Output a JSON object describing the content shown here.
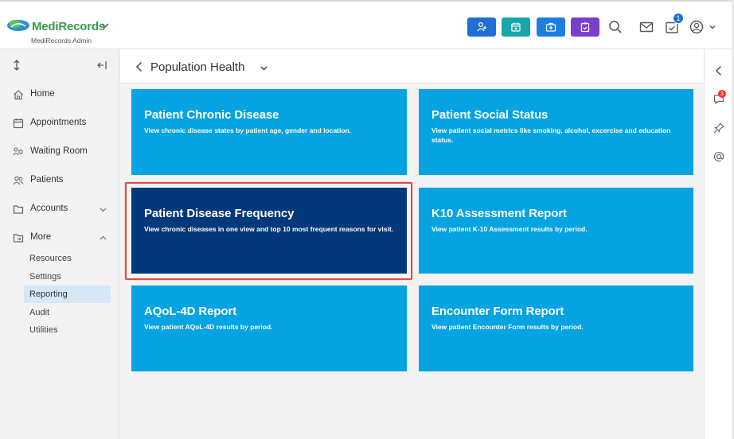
{
  "header": {
    "brand": "MediRecords",
    "subtitle": "MediRecords Admin",
    "notification_count": "1",
    "action_buttons": [
      {
        "icon": "add-user-icon",
        "color": "#1e6fd6"
      },
      {
        "icon": "calendar-icon",
        "color": "#1aa6a6"
      },
      {
        "icon": "medical-kit-icon",
        "color": "#1e7ee0"
      },
      {
        "icon": "clipboard-icon",
        "color": "#7a3fcf"
      }
    ]
  },
  "sidebar": {
    "items": [
      {
        "label": "Home",
        "icon": "home-icon"
      },
      {
        "label": "Appointments",
        "icon": "calendar-icon"
      },
      {
        "label": "Waiting Room",
        "icon": "waiting-room-icon"
      },
      {
        "label": "Patients",
        "icon": "patients-icon"
      },
      {
        "label": "Accounts",
        "icon": "folder-icon"
      },
      {
        "label": "More",
        "icon": "more-folder-icon"
      }
    ],
    "sub_items": [
      "Resources",
      "Settings",
      "Reporting",
      "Audit",
      "Utilities"
    ],
    "active_sub_item": "Reporting"
  },
  "main": {
    "breadcrumb": "Population Health",
    "tiles": [
      {
        "title": "Patient Chronic Disease",
        "desc": "View chronic disease states by patient age, gender and location."
      },
      {
        "title": "Patient Social Status",
        "desc": "View patient social metrics like smoking, alcohol, excercise and education status."
      },
      {
        "title": "Patient Disease Frequency",
        "desc": "View chronic diseases in one view and top 10 most frequent reasons for visit."
      },
      {
        "title": "K10 Assessment Report",
        "desc": "View patient K-10 Assessment results by period."
      },
      {
        "title": "AQoL-4D Report",
        "desc": "View patient AQoL-4D results by period."
      },
      {
        "title": "Encounter Form Report",
        "desc": "View patient Encounter Form results by period."
      }
    ],
    "selected_tile": "Patient Disease Frequency"
  },
  "rail": {
    "chat_badge": "3"
  },
  "colors": {
    "tile": "#05a3e1",
    "tile_selected": "#03387a",
    "highlight": "#e14a4a",
    "brand_green": "#3a9b4a"
  }
}
